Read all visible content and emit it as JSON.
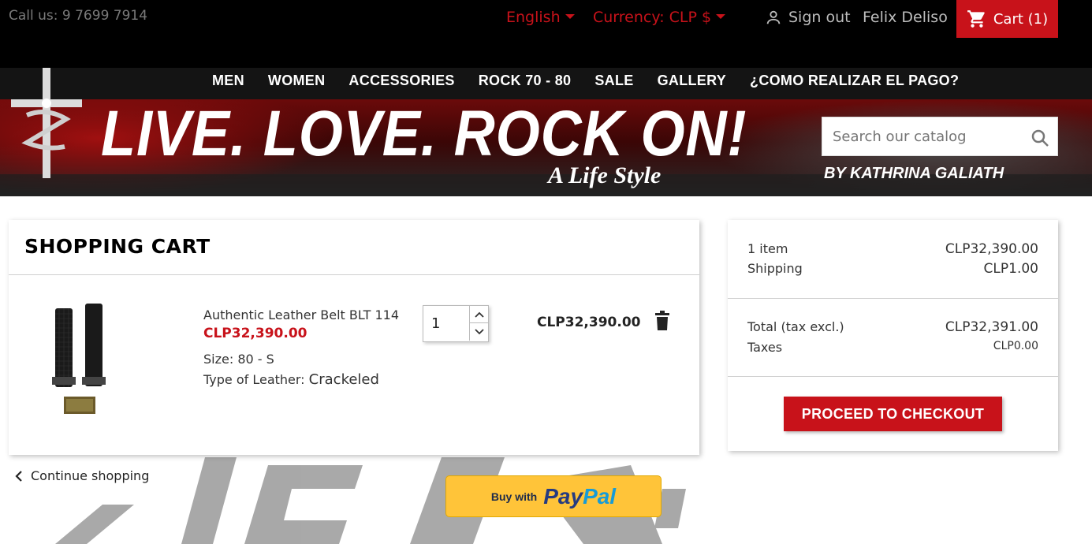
{
  "header": {
    "call_us": "Call us: 9 7699 7914",
    "language": "English",
    "currency": "Currency: CLP $",
    "sign_out": "Sign out",
    "username": "Felix Deliso",
    "cart": "Cart (1)"
  },
  "nav": {
    "items": [
      "MEN",
      "WOMEN",
      "ACCESSORIES",
      "ROCK 70 - 80",
      "SALE",
      "GALLERY",
      "¿COMO REALIZAR EL PAGO?"
    ]
  },
  "banner": {
    "slogan": "LIVE. LOVE. ROCK ON!",
    "tagline": "A Life Style",
    "byline": "BY KATHRINA GALIATH"
  },
  "search": {
    "placeholder": "Search our catalog"
  },
  "cart": {
    "title": "SHOPPING CART",
    "product": {
      "name": "Authentic Leather Belt BLT 114",
      "price": "CLP32,390.00",
      "size_label": "Size:",
      "size_value": "80 - S",
      "leather_label": "Type of Leather:",
      "leather_value": "Crackeled",
      "quantity": "1",
      "line_total": "CLP32,390.00"
    },
    "continue_shopping": "Continue shopping",
    "paypal_buy": "Buy with",
    "paypal_brand_a": "Pay",
    "paypal_brand_b": "Pal"
  },
  "summary": {
    "items_label": "1 item",
    "items_value": "CLP32,390.00",
    "shipping_label": "Shipping",
    "shipping_value": "CLP1.00",
    "total_label": "Total (tax excl.)",
    "total_value": "CLP32,391.00",
    "taxes_label": "Taxes",
    "taxes_value": "CLP0.00",
    "checkout_button": "PROCEED TO CHECKOUT"
  },
  "colors": {
    "accent": "#c8121a",
    "topbar": "#000000",
    "paypal_yellow": "#ffc439"
  }
}
